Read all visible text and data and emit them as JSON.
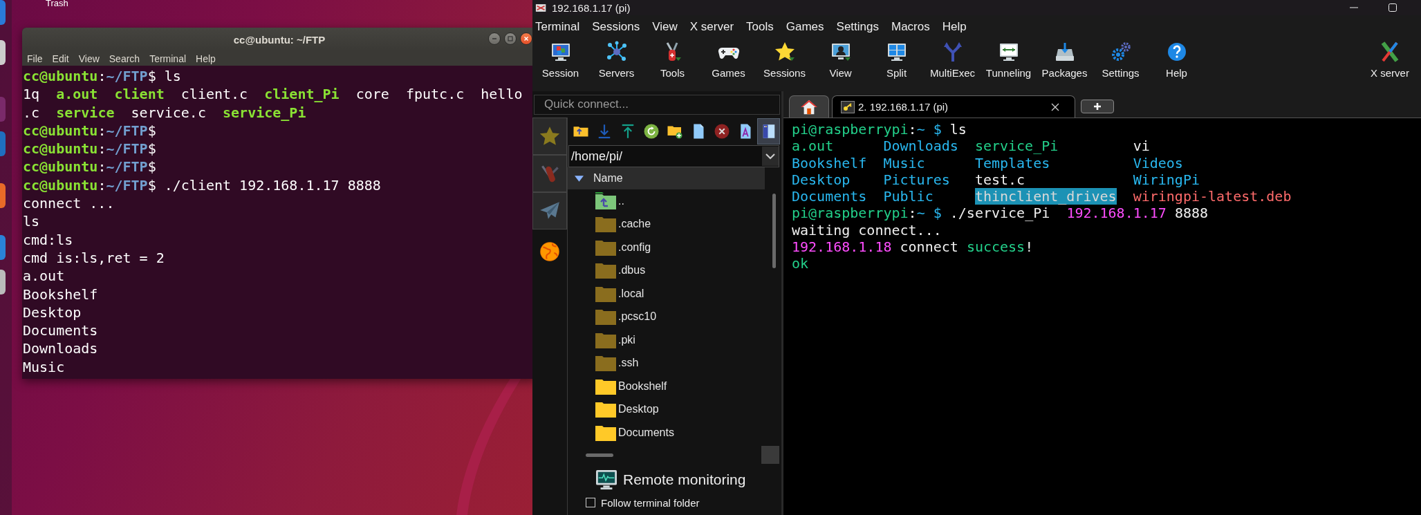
{
  "desktop": {
    "trash_label": "Trash"
  },
  "ubuntu_terminal": {
    "title": "cc@ubuntu: ~/FTP",
    "menu": [
      "File",
      "Edit",
      "View",
      "Search",
      "Terminal",
      "Help"
    ],
    "lines": [
      {
        "segments": [
          {
            "kind": "user",
            "text": "cc@ubuntu"
          },
          {
            "kind": "plain",
            "text": ":"
          },
          {
            "kind": "path",
            "text": "~/FTP"
          },
          {
            "kind": "plain",
            "text": "$ ls"
          }
        ]
      },
      {
        "segments": [
          {
            "kind": "plain",
            "text": "1q  "
          },
          {
            "kind": "exec",
            "text": "a.out  "
          },
          {
            "kind": "exec",
            "text": "client"
          },
          {
            "kind": "plain",
            "text": "  client.c  "
          },
          {
            "kind": "exec",
            "text": "client_Pi"
          },
          {
            "kind": "plain",
            "text": "  core  fputc.c  hello"
          }
        ]
      },
      {
        "segments": [
          {
            "kind": "plain",
            "text": ".c  "
          },
          {
            "kind": "exec",
            "text": "service"
          },
          {
            "kind": "plain",
            "text": "  service.c  "
          },
          {
            "kind": "exec",
            "text": "service_Pi"
          }
        ]
      },
      {
        "segments": [
          {
            "kind": "user",
            "text": "cc@ubuntu"
          },
          {
            "kind": "plain",
            "text": ":"
          },
          {
            "kind": "path",
            "text": "~/FTP"
          },
          {
            "kind": "plain",
            "text": "$"
          }
        ]
      },
      {
        "segments": [
          {
            "kind": "user",
            "text": "cc@ubuntu"
          },
          {
            "kind": "plain",
            "text": ":"
          },
          {
            "kind": "path",
            "text": "~/FTP"
          },
          {
            "kind": "plain",
            "text": "$"
          }
        ]
      },
      {
        "segments": [
          {
            "kind": "user",
            "text": "cc@ubuntu"
          },
          {
            "kind": "plain",
            "text": ":"
          },
          {
            "kind": "path",
            "text": "~/FTP"
          },
          {
            "kind": "plain",
            "text": "$"
          }
        ]
      },
      {
        "segments": [
          {
            "kind": "user",
            "text": "cc@ubuntu"
          },
          {
            "kind": "plain",
            "text": ":"
          },
          {
            "kind": "path",
            "text": "~/FTP"
          },
          {
            "kind": "plain",
            "text": "$ ./client 192.168.1.17 8888"
          }
        ]
      },
      {
        "segments": [
          {
            "kind": "plain",
            "text": "connect ..."
          }
        ]
      },
      {
        "segments": [
          {
            "kind": "plain",
            "text": "ls"
          }
        ]
      },
      {
        "segments": [
          {
            "kind": "plain",
            "text": "cmd:ls"
          }
        ]
      },
      {
        "segments": [
          {
            "kind": "plain",
            "text": "cmd is:ls,ret = 2"
          }
        ]
      },
      {
        "segments": [
          {
            "kind": "plain",
            "text": "a.out"
          }
        ]
      },
      {
        "segments": [
          {
            "kind": "plain",
            "text": "Bookshelf"
          }
        ]
      },
      {
        "segments": [
          {
            "kind": "plain",
            "text": "Desktop"
          }
        ]
      },
      {
        "segments": [
          {
            "kind": "plain",
            "text": "Documents"
          }
        ]
      },
      {
        "segments": [
          {
            "kind": "plain",
            "text": "Downloads"
          }
        ]
      },
      {
        "segments": [
          {
            "kind": "plain",
            "text": "Music"
          }
        ]
      }
    ]
  },
  "mobaxterm": {
    "title": "192.168.1.17 (pi)",
    "menu": [
      "Terminal",
      "Sessions",
      "View",
      "X server",
      "Tools",
      "Games",
      "Settings",
      "Macros",
      "Help"
    ],
    "toolbar": [
      "Session",
      "Servers",
      "Tools",
      "Games",
      "Sessions",
      "View",
      "Split",
      "MultiExec",
      "Tunneling",
      "Packages",
      "Settings",
      "Help"
    ],
    "xserver_button": "X server",
    "quick_connect": {
      "placeholder": "Quick connect..."
    },
    "side_tabs": [
      {
        "selected": false
      },
      {
        "selected": false
      },
      {
        "selected": false
      },
      {
        "selected": true
      }
    ],
    "browser_tools": [
      {
        "active": false
      },
      {
        "active": false
      },
      {
        "active": false
      },
      {
        "active": false
      },
      {
        "active": false
      },
      {
        "active": false
      },
      {
        "active": false
      },
      {
        "active": false
      },
      {
        "active": true
      }
    ],
    "path": "/home/pi/",
    "column": "Name",
    "files": [
      {
        "name": "..",
        "kind": "parent"
      },
      {
        "name": ".cache",
        "kind": "hidden"
      },
      {
        "name": ".config",
        "kind": "hidden"
      },
      {
        "name": ".dbus",
        "kind": "hidden"
      },
      {
        "name": ".local",
        "kind": "hidden"
      },
      {
        "name": ".pcsc10",
        "kind": "hidden"
      },
      {
        "name": ".pki",
        "kind": "hidden"
      },
      {
        "name": ".ssh",
        "kind": "hidden"
      },
      {
        "name": "Bookshelf",
        "kind": "folder"
      },
      {
        "name": "Desktop",
        "kind": "folder"
      },
      {
        "name": "Documents",
        "kind": "folder"
      }
    ],
    "remote_monitoring": "Remote monitoring",
    "follow_folder": {
      "label": "Follow terminal folder",
      "checked": false
    },
    "tabs": [
      {
        "kind": "home",
        "selected": false
      },
      {
        "kind": "session",
        "label": "2. 192.168.1.17 (pi)",
        "selected": true
      }
    ],
    "terminal": [
      {
        "kind": "text",
        "segments": [
          {
            "kind": "host",
            "text": "pi@raspberrypi"
          },
          {
            "kind": "plain",
            "text": ":"
          },
          {
            "kind": "dir",
            "text": "~ $"
          },
          {
            "kind": "plain",
            "text": " ls"
          }
        ]
      },
      {
        "kind": "listing",
        "rows": [
          [
            {
              "kind": "exec",
              "text": "a.out"
            },
            {
              "kind": "dir",
              "text": "Downloads"
            },
            {
              "kind": "exec",
              "text": "service_Pi"
            },
            {
              "kind": "plain",
              "text": "vi"
            }
          ],
          [
            {
              "kind": "dir",
              "text": "Bookshelf"
            },
            {
              "kind": "dir",
              "text": "Music"
            },
            {
              "kind": "dir",
              "text": "Templates"
            },
            {
              "kind": "dir",
              "text": "Videos"
            }
          ],
          [
            {
              "kind": "dir",
              "text": "Desktop"
            },
            {
              "kind": "dir",
              "text": "Pictures"
            },
            {
              "kind": "plain",
              "text": "test.c"
            },
            {
              "kind": "dir",
              "text": "WiringPi"
            }
          ],
          [
            {
              "kind": "dir",
              "text": "Documents"
            },
            {
              "kind": "dir",
              "text": "Public"
            },
            {
              "kind": "highlight",
              "text": "thinclient_drives"
            },
            {
              "kind": "archive",
              "text": "wiringpi-latest.deb"
            }
          ]
        ]
      },
      {
        "kind": "text",
        "segments": [
          {
            "kind": "host",
            "text": "pi@raspberrypi"
          },
          {
            "kind": "plain",
            "text": ":"
          },
          {
            "kind": "dir",
            "text": "~ $"
          },
          {
            "kind": "plain",
            "text": " ./service_Pi  "
          },
          {
            "kind": "ip",
            "text": "192.168.1.17"
          },
          {
            "kind": "plain",
            "text": " 8888"
          }
        ]
      },
      {
        "kind": "text",
        "segments": [
          {
            "kind": "plain",
            "text": "waiting connect..."
          }
        ]
      },
      {
        "kind": "text",
        "segments": [
          {
            "kind": "ip",
            "text": "192.168.1.18"
          },
          {
            "kind": "plain",
            "text": " connect "
          },
          {
            "kind": "exec",
            "text": "success"
          },
          {
            "kind": "plain",
            "text": "!"
          }
        ]
      },
      {
        "kind": "text",
        "segments": [
          {
            "kind": "exec",
            "text": "ok"
          }
        ]
      }
    ]
  }
}
